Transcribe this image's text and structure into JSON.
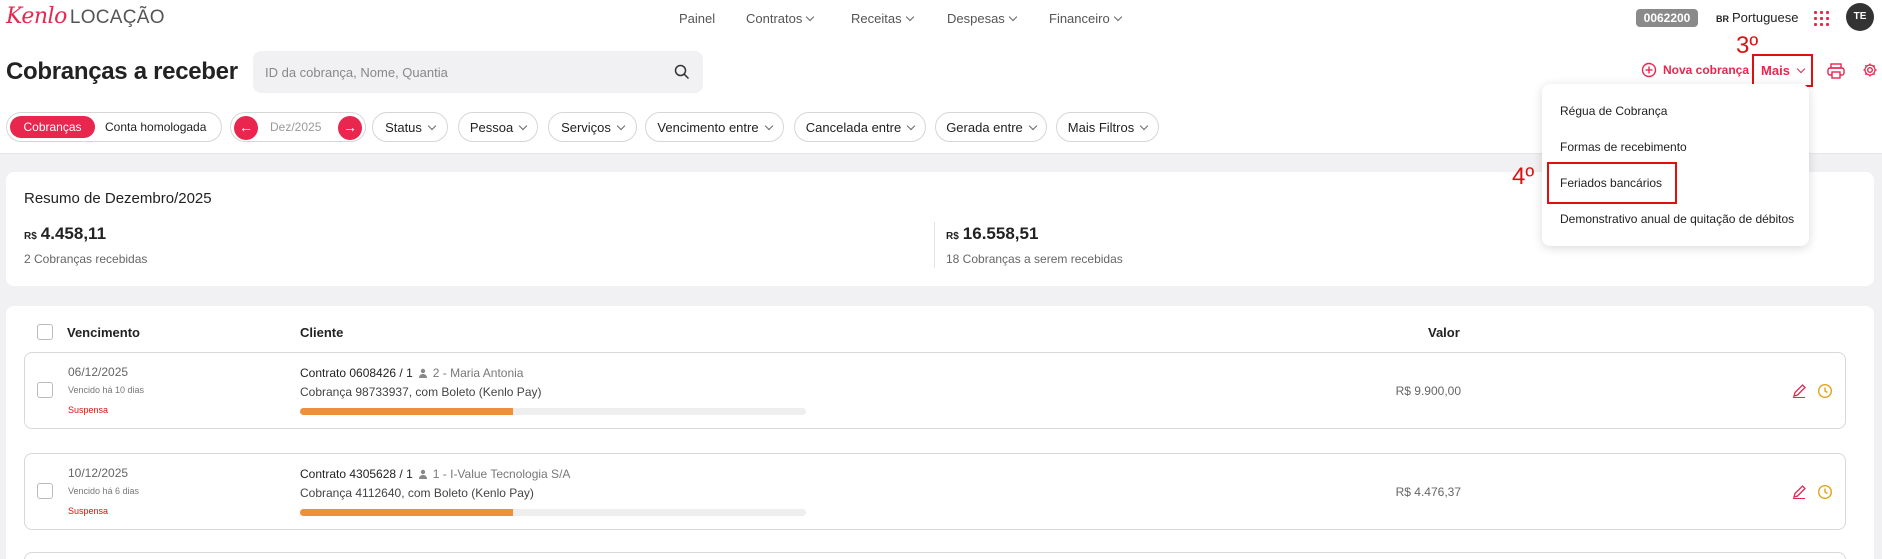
{
  "app": {
    "brand": "Kenlo",
    "product": "LOCAÇÃO"
  },
  "nav": [
    {
      "label": "Painel",
      "dropdown": false
    },
    {
      "label": "Contratos",
      "dropdown": true
    },
    {
      "label": "Receitas",
      "dropdown": true
    },
    {
      "label": "Despesas",
      "dropdown": true
    },
    {
      "label": "Financeiro",
      "dropdown": true
    }
  ],
  "topbar": {
    "code": "0062200",
    "lang_flag": "BR",
    "lang": "Portuguese",
    "avatar": "TE"
  },
  "header": {
    "title": "Cobranças a receber",
    "search_placeholder": "ID da cobrança, Nome, Quantia",
    "new_charge": "Nova cobrança",
    "more": "Mais",
    "step3": "3º",
    "step4": "4º"
  },
  "filters": {
    "segments": [
      "Cobranças",
      "Conta homologada"
    ],
    "month": "Dez/2025",
    "pills": [
      "Status",
      "Pessoa",
      "Serviços",
      "Vencimento entre",
      "Cancelada entre",
      "Gerada entre",
      "Mais Filtros"
    ]
  },
  "dropdown": {
    "items": [
      "Régua de Cobrança",
      "Formas de recebimento",
      "Feriados bancários",
      "Demonstrativo anual de quitação de débitos"
    ]
  },
  "summary": {
    "title": "Resumo de Dezembro/2025",
    "currency": "R$",
    "received_value": "4.458,11",
    "received_label": "2 Cobranças recebidas",
    "pending_value": "16.558,51",
    "pending_label": "18 Cobranças a serem recebidas"
  },
  "table": {
    "columns": [
      "Vencimento",
      "Cliente",
      "Valor"
    ],
    "rows": [
      {
        "date": "06/12/2025",
        "due": "Vencido há 10 dias",
        "status": "Suspensa",
        "contract": "Contrato 0608426 / 1",
        "client": "2 - Maria Antonia",
        "charge": "Cobrança 98733937, com Boleto (Kenlo Pay)",
        "progress": 0.42,
        "value": "R$ 9.900,00"
      },
      {
        "date": "10/12/2025",
        "due": "Vencido há 6 dias",
        "status": "Suspensa",
        "contract": "Contrato 4305628 / 1",
        "client": "1 - I-Value Tecnologia S/A",
        "charge": "Cobrança 4112640, com Boleto (Kenlo Pay)",
        "progress": 0.42,
        "value": "R$ 4.476,37"
      }
    ]
  },
  "colors": {
    "accent": "#e8264e",
    "annotation": "#e01010",
    "progress": "#ef8f3a"
  }
}
